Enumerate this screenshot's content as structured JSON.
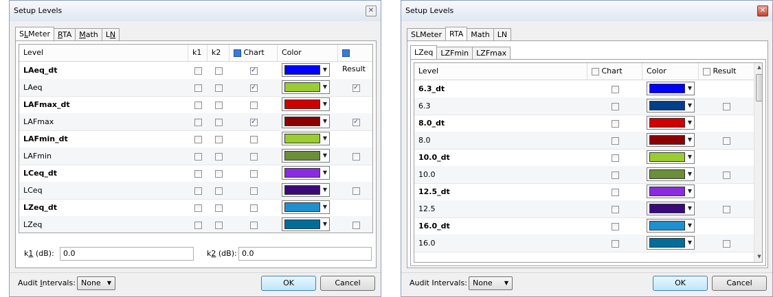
{
  "dialogs": [
    {
      "title": "Setup Levels",
      "tabs": [
        {
          "pre": "S",
          "ul": "L",
          "post": "Meter"
        },
        {
          "pre": "",
          "ul": "R",
          "post": "TA"
        },
        {
          "pre": "",
          "ul": "M",
          "post": "ath"
        },
        {
          "pre": "L",
          "ul": "N",
          "post": ""
        }
      ],
      "columns": {
        "level": "Level",
        "k1": "k1",
        "k2": "k2",
        "chart": "Chart",
        "color": "Color",
        "result": "Result"
      },
      "rows": [
        {
          "level": "LAeq_dt",
          "bold": true,
          "k1": false,
          "k2": false,
          "chart": true,
          "color": "#0000ff",
          "result": null
        },
        {
          "level": "LAeq",
          "bold": false,
          "k1": false,
          "k2": false,
          "chart": true,
          "color": "#9acd32",
          "result": true
        },
        {
          "level": "LAFmax_dt",
          "bold": true,
          "k1": false,
          "k2": false,
          "chart": false,
          "color": "#d10000",
          "result": null
        },
        {
          "level": "LAFmax",
          "bold": false,
          "k1": false,
          "k2": false,
          "chart": true,
          "color": "#8b0000",
          "result": true
        },
        {
          "level": "LAFmin_dt",
          "bold": true,
          "k1": false,
          "k2": false,
          "chart": false,
          "color": "#9acd32",
          "result": null
        },
        {
          "level": "LAFmin",
          "bold": false,
          "k1": false,
          "k2": false,
          "chart": false,
          "color": "#6b8e3a",
          "result": false
        },
        {
          "level": "LCeq_dt",
          "bold": true,
          "k1": false,
          "k2": false,
          "chart": false,
          "color": "#8a2be2",
          "result": null
        },
        {
          "level": "LCeq",
          "bold": false,
          "k1": false,
          "k2": false,
          "chart": false,
          "color": "#3a0a7a",
          "result": false
        },
        {
          "level": "LZeq_dt",
          "bold": true,
          "k1": false,
          "k2": false,
          "chart": false,
          "color": "#1e90d0",
          "result": null
        },
        {
          "level": "LZeq",
          "bold": false,
          "k1": false,
          "k2": false,
          "chart": false,
          "color": "#006e9a",
          "result": false
        }
      ],
      "k1": {
        "pre": "k",
        "ul": "1",
        "post": " (dB):",
        "value": "0.0"
      },
      "k2": {
        "pre": "k",
        "ul": "2",
        "post": " (dB):",
        "value": "0.0"
      },
      "audit": {
        "pre": "Audit ",
        "ul": "I",
        "post": "ntervals:",
        "value": "None"
      },
      "ok": "OK",
      "cancel": "Cancel"
    },
    {
      "title": "Setup Levels",
      "tabs": [
        "SLMeter",
        "RTA",
        "Math",
        "LN"
      ],
      "subtabs": [
        "LZeq",
        "LZFmin",
        "LZFmax"
      ],
      "columns": {
        "level": "Level",
        "chart": "Chart",
        "color": "Color",
        "result": "Result"
      },
      "rows": [
        {
          "level": "6.3_dt",
          "bold": true,
          "chart": false,
          "color": "#0000ff",
          "result": null
        },
        {
          "level": "6.3",
          "bold": false,
          "chart": false,
          "color": "#003f8a",
          "result": false
        },
        {
          "level": "8.0_dt",
          "bold": true,
          "chart": false,
          "color": "#d10000",
          "result": null
        },
        {
          "level": "8.0",
          "bold": false,
          "chart": false,
          "color": "#8b0000",
          "result": false
        },
        {
          "level": "10.0_dt",
          "bold": true,
          "chart": false,
          "color": "#9acd32",
          "result": null
        },
        {
          "level": "10.0",
          "bold": false,
          "chart": false,
          "color": "#6b8e3a",
          "result": false
        },
        {
          "level": "12.5_dt",
          "bold": true,
          "chart": false,
          "color": "#8a2be2",
          "result": null
        },
        {
          "level": "12.5",
          "bold": false,
          "chart": false,
          "color": "#3a0a7a",
          "result": false
        },
        {
          "level": "16.0_dt",
          "bold": true,
          "chart": false,
          "color": "#1e90d0",
          "result": null
        },
        {
          "level": "16.0",
          "bold": false,
          "chart": false,
          "color": "#006e9a",
          "result": false
        }
      ],
      "audit": "Audit Intervals:",
      "audit_value": "None",
      "ok": "OK",
      "cancel": "Cancel"
    }
  ]
}
